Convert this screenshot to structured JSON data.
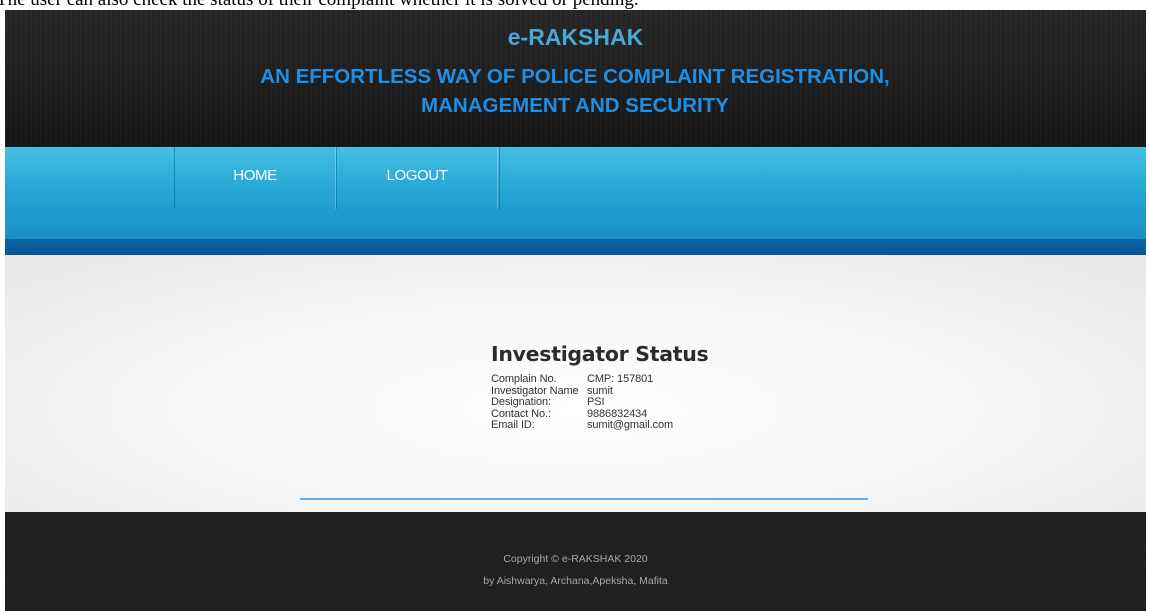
{
  "caption": {
    "text": "The user can also check the status of their complaint whether it is solved or pending."
  },
  "header": {
    "brand": "e-RAKSHAK",
    "tagline_line1": "AN EFFORTLESS WAY OF POLICE COMPLAINT REGISTRATION,",
    "tagline_line2": "MANAGEMENT AND SECURITY"
  },
  "nav": {
    "home": "HOME",
    "logout": "LOGOUT"
  },
  "status": {
    "title": "Investigator Status",
    "rows": [
      {
        "label": "Complain No.",
        "value": "CMP: 157801"
      },
      {
        "label": "Investigator Name",
        "value": "sumit"
      },
      {
        "label": "Designation:",
        "value": "PSI"
      },
      {
        "label": "Contact No.:",
        "value": "9886832434"
      },
      {
        "label": "Email ID:",
        "value": "sumit@gmail.com"
      }
    ]
  },
  "footer": {
    "copyright": "Copyright © e-RAKSHAK 2020",
    "authors": "by Aishwarya, Archana,Apeksha, Mafita"
  },
  "colors": {
    "brand": "#49a8d8",
    "tagline": "#1f8fe6",
    "nav": "#28a6d6",
    "nav_bottom": "#0e62a3",
    "accent_line": "#58b5e2"
  }
}
